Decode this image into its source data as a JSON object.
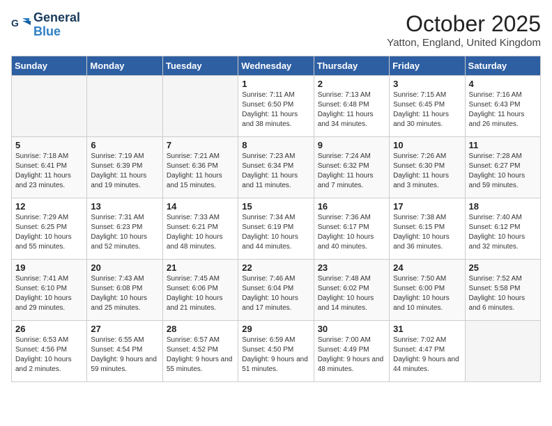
{
  "header": {
    "logo_line1": "General",
    "logo_line2": "Blue",
    "month": "October 2025",
    "location": "Yatton, England, United Kingdom"
  },
  "weekdays": [
    "Sunday",
    "Monday",
    "Tuesday",
    "Wednesday",
    "Thursday",
    "Friday",
    "Saturday"
  ],
  "weeks": [
    [
      {
        "day": "",
        "empty": true
      },
      {
        "day": "",
        "empty": true
      },
      {
        "day": "",
        "empty": true
      },
      {
        "day": "1",
        "sunrise": "7:11 AM",
        "sunset": "6:50 PM",
        "daylight": "11 hours and 38 minutes."
      },
      {
        "day": "2",
        "sunrise": "7:13 AM",
        "sunset": "6:48 PM",
        "daylight": "11 hours and 34 minutes."
      },
      {
        "day": "3",
        "sunrise": "7:15 AM",
        "sunset": "6:45 PM",
        "daylight": "11 hours and 30 minutes."
      },
      {
        "day": "4",
        "sunrise": "7:16 AM",
        "sunset": "6:43 PM",
        "daylight": "11 hours and 26 minutes."
      }
    ],
    [
      {
        "day": "5",
        "sunrise": "7:18 AM",
        "sunset": "6:41 PM",
        "daylight": "11 hours and 23 minutes."
      },
      {
        "day": "6",
        "sunrise": "7:19 AM",
        "sunset": "6:39 PM",
        "daylight": "11 hours and 19 minutes."
      },
      {
        "day": "7",
        "sunrise": "7:21 AM",
        "sunset": "6:36 PM",
        "daylight": "11 hours and 15 minutes."
      },
      {
        "day": "8",
        "sunrise": "7:23 AM",
        "sunset": "6:34 PM",
        "daylight": "11 hours and 11 minutes."
      },
      {
        "day": "9",
        "sunrise": "7:24 AM",
        "sunset": "6:32 PM",
        "daylight": "11 hours and 7 minutes."
      },
      {
        "day": "10",
        "sunrise": "7:26 AM",
        "sunset": "6:30 PM",
        "daylight": "11 hours and 3 minutes."
      },
      {
        "day": "11",
        "sunrise": "7:28 AM",
        "sunset": "6:27 PM",
        "daylight": "10 hours and 59 minutes."
      }
    ],
    [
      {
        "day": "12",
        "sunrise": "7:29 AM",
        "sunset": "6:25 PM",
        "daylight": "10 hours and 55 minutes."
      },
      {
        "day": "13",
        "sunrise": "7:31 AM",
        "sunset": "6:23 PM",
        "daylight": "10 hours and 52 minutes."
      },
      {
        "day": "14",
        "sunrise": "7:33 AM",
        "sunset": "6:21 PM",
        "daylight": "10 hours and 48 minutes."
      },
      {
        "day": "15",
        "sunrise": "7:34 AM",
        "sunset": "6:19 PM",
        "daylight": "10 hours and 44 minutes."
      },
      {
        "day": "16",
        "sunrise": "7:36 AM",
        "sunset": "6:17 PM",
        "daylight": "10 hours and 40 minutes."
      },
      {
        "day": "17",
        "sunrise": "7:38 AM",
        "sunset": "6:15 PM",
        "daylight": "10 hours and 36 minutes."
      },
      {
        "day": "18",
        "sunrise": "7:40 AM",
        "sunset": "6:12 PM",
        "daylight": "10 hours and 32 minutes."
      }
    ],
    [
      {
        "day": "19",
        "sunrise": "7:41 AM",
        "sunset": "6:10 PM",
        "daylight": "10 hours and 29 minutes."
      },
      {
        "day": "20",
        "sunrise": "7:43 AM",
        "sunset": "6:08 PM",
        "daylight": "10 hours and 25 minutes."
      },
      {
        "day": "21",
        "sunrise": "7:45 AM",
        "sunset": "6:06 PM",
        "daylight": "10 hours and 21 minutes."
      },
      {
        "day": "22",
        "sunrise": "7:46 AM",
        "sunset": "6:04 PM",
        "daylight": "10 hours and 17 minutes."
      },
      {
        "day": "23",
        "sunrise": "7:48 AM",
        "sunset": "6:02 PM",
        "daylight": "10 hours and 14 minutes."
      },
      {
        "day": "24",
        "sunrise": "7:50 AM",
        "sunset": "6:00 PM",
        "daylight": "10 hours and 10 minutes."
      },
      {
        "day": "25",
        "sunrise": "7:52 AM",
        "sunset": "5:58 PM",
        "daylight": "10 hours and 6 minutes."
      }
    ],
    [
      {
        "day": "26",
        "sunrise": "6:53 AM",
        "sunset": "4:56 PM",
        "daylight": "10 hours and 2 minutes."
      },
      {
        "day": "27",
        "sunrise": "6:55 AM",
        "sunset": "4:54 PM",
        "daylight": "9 hours and 59 minutes."
      },
      {
        "day": "28",
        "sunrise": "6:57 AM",
        "sunset": "4:52 PM",
        "daylight": "9 hours and 55 minutes."
      },
      {
        "day": "29",
        "sunrise": "6:59 AM",
        "sunset": "4:50 PM",
        "daylight": "9 hours and 51 minutes."
      },
      {
        "day": "30",
        "sunrise": "7:00 AM",
        "sunset": "4:49 PM",
        "daylight": "9 hours and 48 minutes."
      },
      {
        "day": "31",
        "sunrise": "7:02 AM",
        "sunset": "4:47 PM",
        "daylight": "9 hours and 44 minutes."
      },
      {
        "day": "",
        "empty": true
      }
    ]
  ]
}
